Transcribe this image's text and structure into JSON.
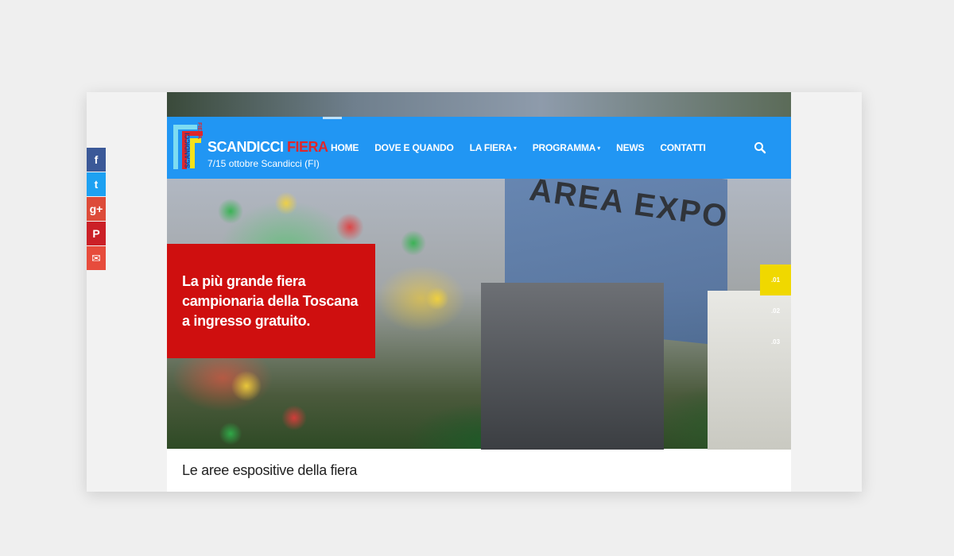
{
  "site": {
    "logo_title_main": "SCANDICCI",
    "logo_title_accent": "FIERA",
    "logo_subtitle": "7/15 ottobre Scandicci (FI)",
    "logo_vertical_left": "SCANDICCI",
    "logo_vertical_right": "FIERA"
  },
  "nav": {
    "items": [
      {
        "label": "HOME",
        "caret": false
      },
      {
        "label": "DOVE E QUANDO",
        "caret": false
      },
      {
        "label": "LA FIERA",
        "caret": true
      },
      {
        "label": "PROGRAMMA",
        "caret": true
      },
      {
        "label": "NEWS",
        "caret": false
      },
      {
        "label": "CONTATTI",
        "caret": false
      }
    ],
    "search_icon": "search-icon"
  },
  "hero": {
    "sign_text": "AREA EXPO",
    "callout": "La più grande fiera campionaria della Toscana a ingresso gratuito.",
    "slides": [
      {
        "label": ".01",
        "active": true
      },
      {
        "label": ".02",
        "active": false
      },
      {
        "label": ".03",
        "active": false
      }
    ]
  },
  "section": {
    "heading": "Le aree espositive della fiera"
  },
  "share": {
    "buttons": [
      {
        "icon": "facebook-icon",
        "glyph": "f",
        "color": "#3b5998"
      },
      {
        "icon": "twitter-icon",
        "glyph": "t",
        "color": "#1da1f2"
      },
      {
        "icon": "google-plus-icon",
        "glyph": "g+",
        "color": "#dd4b39"
      },
      {
        "icon": "pinterest-icon",
        "glyph": "P",
        "color": "#cb2027"
      },
      {
        "icon": "email-icon",
        "glyph": "✉",
        "color": "#e74c3c"
      }
    ]
  },
  "colors": {
    "nav_bg": "#2196f3",
    "callout_bg": "#cf0f0f",
    "active_slide": "#f0d800"
  }
}
